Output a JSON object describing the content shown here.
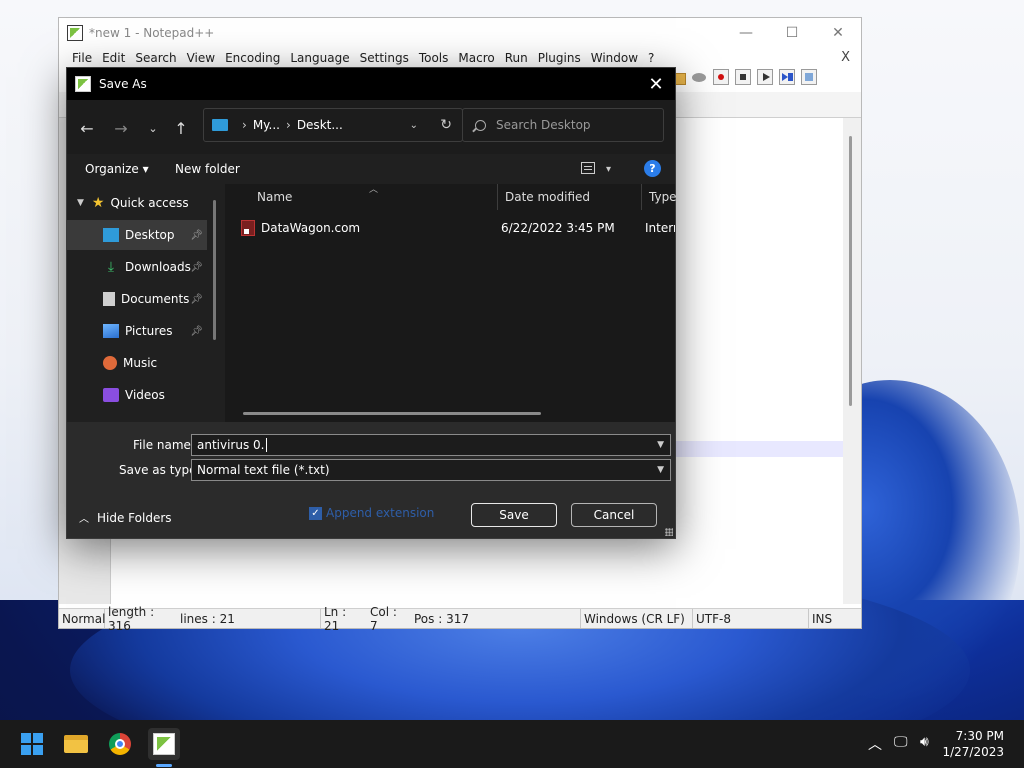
{
  "notepad": {
    "title": "*new 1 - Notepad++",
    "menu": [
      "File",
      "Edit",
      "Search",
      "View",
      "Encoding",
      "Language",
      "Settings",
      "Tools",
      "Macro",
      "Run",
      "Plugins",
      "Window",
      "?"
    ],
    "close_doc": "X",
    "status": {
      "mode": "Normal",
      "length": "length : 316",
      "lines": "lines : 21",
      "ln": "Ln : 21",
      "col": "Col : 7",
      "pos": "Pos : 317",
      "eol": "Windows (CR LF)",
      "encoding": "UTF-8",
      "ins": "INS"
    }
  },
  "dialog": {
    "title": "Save As",
    "address": {
      "part1": "My...",
      "part2": "Deskt..."
    },
    "search_placeholder": "Search Desktop",
    "organize": "Organize ▾",
    "new_folder": "New folder",
    "help": "?",
    "nav": {
      "quick_access": "Quick access",
      "items": [
        {
          "label": "Desktop",
          "icon": "desktop-icon",
          "color": "#2f9bd9"
        },
        {
          "label": "Downloads",
          "icon": "download-icon",
          "color": "#3bbf6a"
        },
        {
          "label": "Documents",
          "icon": "documents-icon",
          "color": "#cfcfcf"
        },
        {
          "label": "Pictures",
          "icon": "pictures-icon",
          "color": "#3a8ee6"
        },
        {
          "label": "Music",
          "icon": "music-icon",
          "color": "#e06a3a"
        },
        {
          "label": "Videos",
          "icon": "videos-icon",
          "color": "#8a4ee0"
        }
      ]
    },
    "columns": {
      "name": "Name",
      "date": "Date modified",
      "type": "Type"
    },
    "files": [
      {
        "name": "DataWagon.com",
        "date": "6/22/2022 3:45 PM",
        "type": "Intern"
      }
    ],
    "file_name_label": "File name:",
    "file_name_value": "antivirus 0.",
    "save_type_label": "Save as type:",
    "save_type_value": "Normal text file (*.txt)",
    "hide_folders": "Hide Folders",
    "append_extension": "Append extension",
    "save": "Save",
    "cancel": "Cancel"
  },
  "taskbar": {
    "time": "7:30 PM",
    "date": "1/27/2023"
  }
}
